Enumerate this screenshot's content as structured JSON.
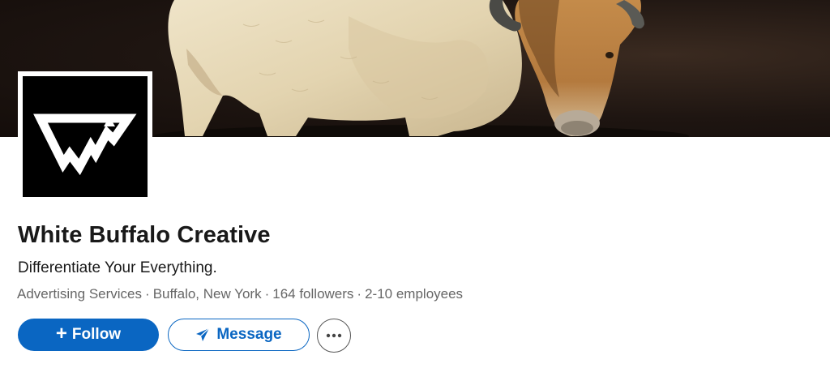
{
  "company": {
    "name": "White Buffalo Creative",
    "tagline": "Differentiate Your Everything.",
    "industry": "Advertising Services",
    "location": "Buffalo, New York",
    "followers": "164 followers",
    "employees": "2-10 employees",
    "separator": "·"
  },
  "actions": {
    "follow_label": "Follow",
    "follow_icon": "plus-icon",
    "message_label": "Message",
    "message_icon": "send-icon",
    "more_icon": "ellipsis-icon"
  },
  "colors": {
    "primary": "#0a66c2",
    "text": "#191919",
    "muted": "#666666"
  }
}
